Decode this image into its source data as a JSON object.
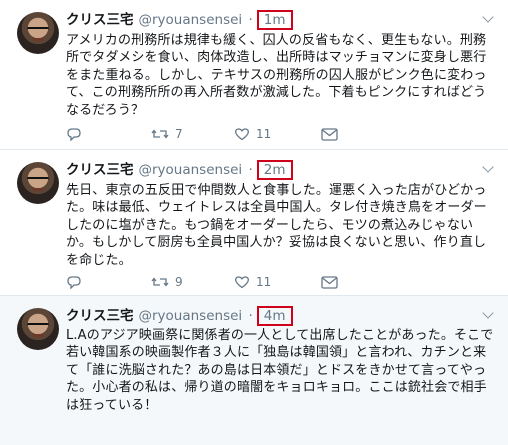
{
  "tweets": [
    {
      "name": "クリス三宅",
      "handle": "@ryouansensei",
      "sep": "·",
      "time": "1m",
      "text": "アメリカの刑務所は規律も緩く、囚人の反省もなく、更生もない。刑務所でタダメシを食い、肉体改造し、出所時はマッチョマンに変身し悪行をまた重ねる。しかし、テキサスの刑務所の囚人服がピンク色に変わって、この刑務所所の再入所者数が激減した。下着もピンクにすればどうなるだろう？",
      "retweets": "7",
      "likes": "11"
    },
    {
      "name": "クリス三宅",
      "handle": "@ryouansensei",
      "sep": "·",
      "time": "2m",
      "text": "先日、東京の五反田で仲間数人と食事した。運悪く入った店がひどかった。味は最低、ウェイトレスは全員中国人。タレ付き焼き鳥をオーダーしたのに塩がきた。もつ鍋をオーダーしたら、モツの煮込みじゃないか。もしかして厨房も全員中国人か？妥協は良くないと思い、作り直しを命じた。",
      "retweets": "9",
      "likes": "11"
    },
    {
      "name": "クリス三宅",
      "handle": "@ryouansensei",
      "sep": "·",
      "time": "4m",
      "text": "L.Aのアジア映画祭に関係者の一人として出席したことがあった。そこで若い韓国系の映画製作者３人に「独島は韓国領」と言われ、カチンと来て「誰に洗脳された？あの島は日本領だ」とドスをきかせて言ってやった。小心者の私は、帰り道の暗闇をキョロキョロ。ここは銃社会で相手は狂っている！",
      "retweets": "",
      "likes": ""
    }
  ],
  "colors": {
    "highlight": "#d0021b",
    "muted": "#657786"
  }
}
